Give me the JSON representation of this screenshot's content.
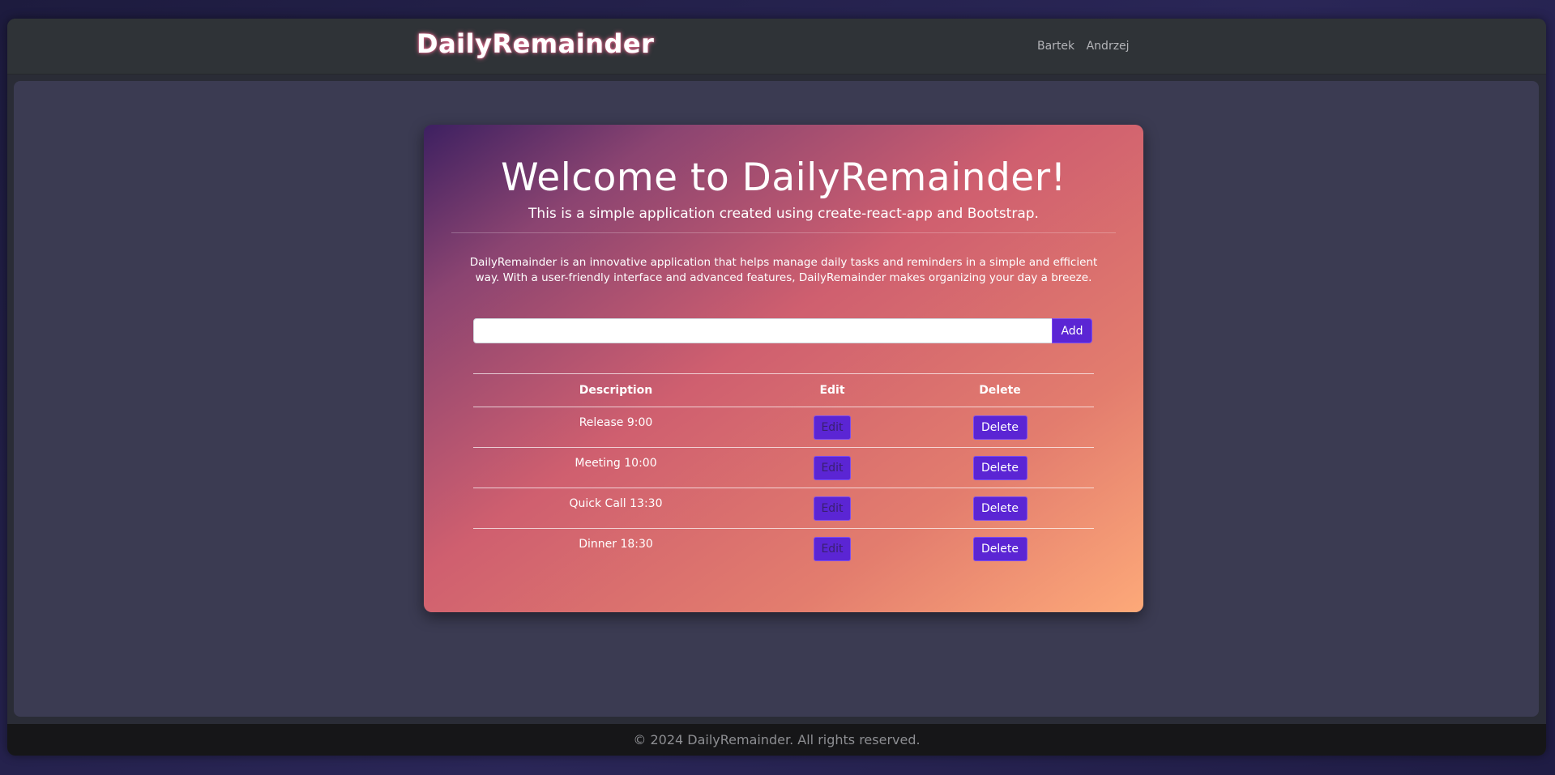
{
  "navbar": {
    "brand": "DailyRemainder",
    "links": [
      "Bartek",
      "Andrzej"
    ]
  },
  "hero": {
    "title": "Welcome to DailyRemainder!",
    "lead": "This is a simple application created using create-react-app and Bootstrap.",
    "description": "DailyRemainder is an innovative application that helps manage daily tasks and reminders in a simple and efficient way. With a user-friendly interface and advanced features, DailyRemainder makes organizing your day a breeze."
  },
  "add_form": {
    "input_value": "",
    "button_label": "Add"
  },
  "table": {
    "headers": [
      "Description",
      "Edit",
      "Delete"
    ],
    "rows": [
      {
        "description": "Release 9:00",
        "edit_label": "Edit",
        "delete_label": "Delete"
      },
      {
        "description": "Meeting 10:00",
        "edit_label": "Edit",
        "delete_label": "Delete"
      },
      {
        "description": "Quick Call 13:30",
        "edit_label": "Edit",
        "delete_label": "Delete"
      },
      {
        "description": "Dinner 18:30",
        "edit_label": "Edit",
        "delete_label": "Delete"
      }
    ]
  },
  "footer": {
    "text": "© 2024 DailyRemainder. All rights reserved."
  },
  "colors": {
    "accent_button": "#5b25d4",
    "brand_glow": "#e86a8f",
    "card_gradient_start": "#3d2061",
    "card_gradient_end": "#fda979"
  }
}
